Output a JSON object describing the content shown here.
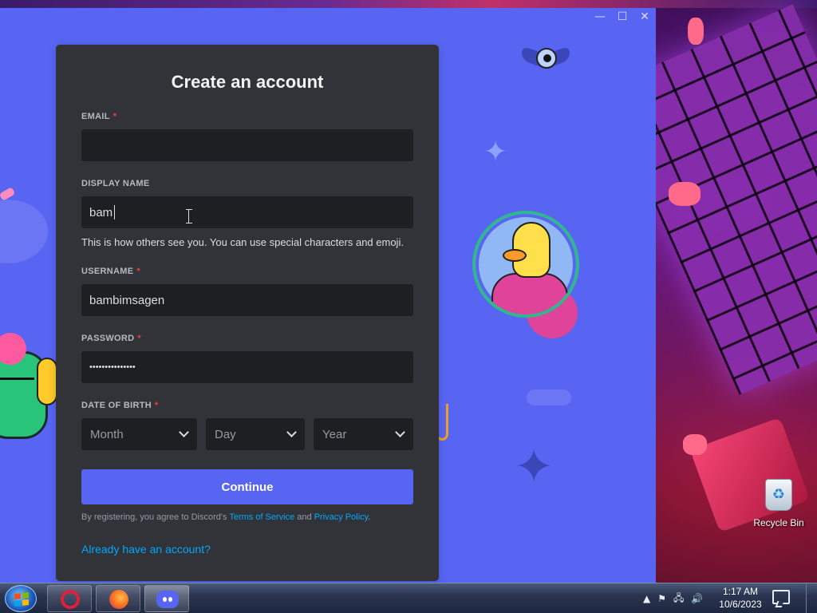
{
  "desktop": {
    "recycle_bin_label": "Recycle Bin"
  },
  "window": {
    "controls": {
      "minimize": "—",
      "maximize": "☐",
      "close": "✕"
    }
  },
  "form": {
    "title": "Create an account",
    "email": {
      "label": "EMAIL",
      "required_mark": "*",
      "value": ""
    },
    "display_name": {
      "label": "DISPLAY NAME",
      "value": "bam",
      "hint": "This is how others see you. You can use special characters and emoji."
    },
    "username": {
      "label": "USERNAME",
      "required_mark": "*",
      "value": "bambimsagen"
    },
    "password": {
      "label": "PASSWORD",
      "required_mark": "*",
      "value": "•••••••••••••••"
    },
    "date_of_birth": {
      "label": "DATE OF BIRTH",
      "required_mark": "*",
      "month_placeholder": "Month",
      "day_placeholder": "Day",
      "year_placeholder": "Year"
    },
    "continue_label": "Continue",
    "legal": {
      "prefix": "By registering, you agree to Discord's ",
      "terms_link": "Terms of Service",
      "middle": " and ",
      "privacy_link": "Privacy Policy",
      "suffix": "."
    },
    "login_link": "Already have an account?"
  },
  "colors": {
    "brand": "#5865f2",
    "card": "#313338",
    "input": "#1e1f22",
    "link": "#00a8fc",
    "required": "#f23f42"
  },
  "taskbar": {
    "apps": [
      {
        "name": "Opera",
        "icon": "opera-icon"
      },
      {
        "name": "Firefox",
        "icon": "firefox-icon"
      },
      {
        "name": "Discord",
        "icon": "discord-icon",
        "active": true
      }
    ],
    "tray": {
      "show_hidden": "▲",
      "action_center": "⚑",
      "network": "🖧",
      "volume": "🔊"
    },
    "clock": {
      "time": "1:17 AM",
      "date": "10/6/2023"
    }
  }
}
